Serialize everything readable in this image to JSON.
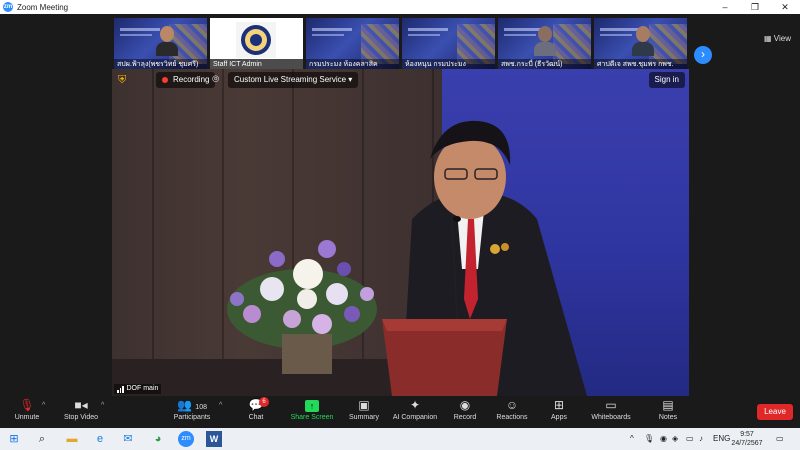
{
  "window": {
    "title": "Zoom Meeting",
    "app_icon_text": "zm",
    "controls": [
      "–",
      "❐",
      "✕"
    ]
  },
  "gallery": {
    "tiles": [
      {
        "name": "สปผ.ฟ้าลุง(พชรวิทย์ ชุมศรี)",
        "kind": "person"
      },
      {
        "name": "Staff ICT Admin",
        "kind": "seal"
      },
      {
        "name": "กรมประมง ห้องคลาสิค",
        "kind": "room"
      },
      {
        "name": "ห้องหนุน กรมประมง",
        "kind": "room"
      },
      {
        "name": "สพช.กระบี่ (ธีรวัฒน์)",
        "kind": "person"
      },
      {
        "name": "ศาปดีเจ สพช.ชุมพร กพช.",
        "kind": "person"
      }
    ],
    "next_icon": "chevron-right-icon",
    "view_label": "View"
  },
  "main_video": {
    "recording_label": "Recording",
    "stream_label": "Custom Live Streaming Service",
    "signin_label": "Sign in",
    "speaker_label": "DOF main"
  },
  "toolbar": {
    "items": [
      {
        "label": "Unmute",
        "icon": "mic-muted-icon",
        "glyph": "🎙"
      },
      {
        "label": "Stop Video",
        "icon": "video-camera-icon",
        "glyph": "▶"
      },
      {
        "label": "Participants",
        "icon": "participants-icon",
        "glyph": "👥",
        "count": "108"
      },
      {
        "label": "Chat",
        "icon": "chat-icon",
        "glyph": "💬",
        "badge": "6"
      },
      {
        "label": "Share Screen",
        "icon": "share-screen-icon",
        "glyph": "↑"
      },
      {
        "label": "Summary",
        "icon": "summary-icon",
        "glyph": "✚"
      },
      {
        "label": "AI Companion",
        "icon": "ai-companion-icon",
        "glyph": "✦"
      },
      {
        "label": "Record",
        "icon": "record-icon",
        "glyph": "◉"
      },
      {
        "label": "Reactions",
        "icon": "reactions-icon",
        "glyph": "☺"
      },
      {
        "label": "Apps",
        "icon": "apps-icon",
        "glyph": "⊞"
      },
      {
        "label": "Whiteboards",
        "icon": "whiteboard-icon",
        "glyph": "▭"
      },
      {
        "label": "Notes",
        "icon": "notes-icon",
        "glyph": "▤"
      }
    ],
    "leave_label": "Leave"
  },
  "taskbar": {
    "language": "ENG",
    "time": "9:57",
    "date": "24/7/2567"
  },
  "colors": {
    "accent": "#2d8cff",
    "share_green": "#23d959",
    "leave_red": "#e02828",
    "stage_blue": "#3a3fae"
  }
}
